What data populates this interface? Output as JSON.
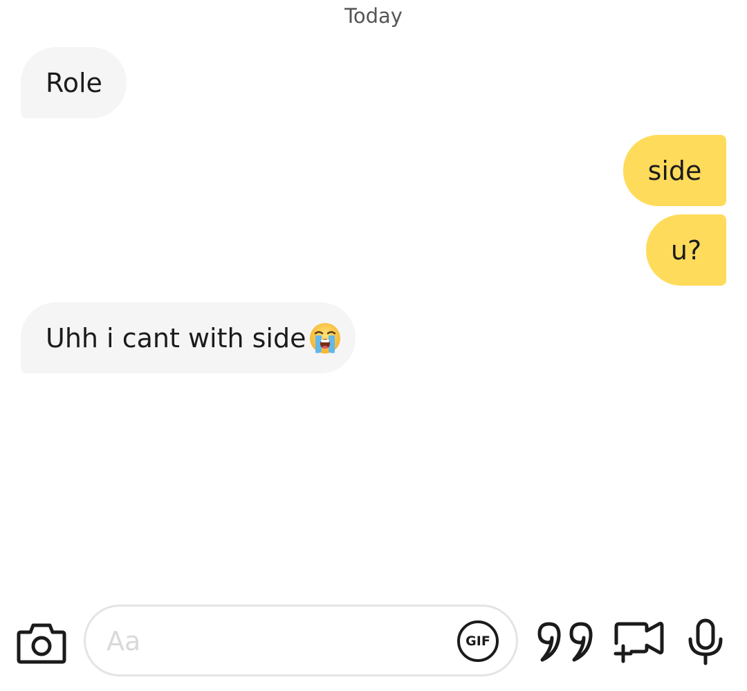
{
  "conversation": {
    "date_label": "Today",
    "messages": [
      {
        "direction": "incoming",
        "text": "Role"
      },
      {
        "direction": "outgoing",
        "text": "side"
      },
      {
        "direction": "outgoing",
        "text": "u?"
      },
      {
        "direction": "incoming",
        "text": "Uhh i cant with side",
        "emoji": "loudly-crying-face"
      }
    ]
  },
  "composer": {
    "placeholder": "Aa",
    "gif_label": "GIF",
    "icons": [
      "camera-icon",
      "gif-icon",
      "quote-icon",
      "video-add-icon",
      "microphone-icon"
    ]
  },
  "colors": {
    "incoming_bubble": "#f5f5f5",
    "outgoing_bubble": "#ffdb5b",
    "text": "#1b1b1b",
    "date_label": "#555555",
    "placeholder": "#d9d9d9"
  }
}
